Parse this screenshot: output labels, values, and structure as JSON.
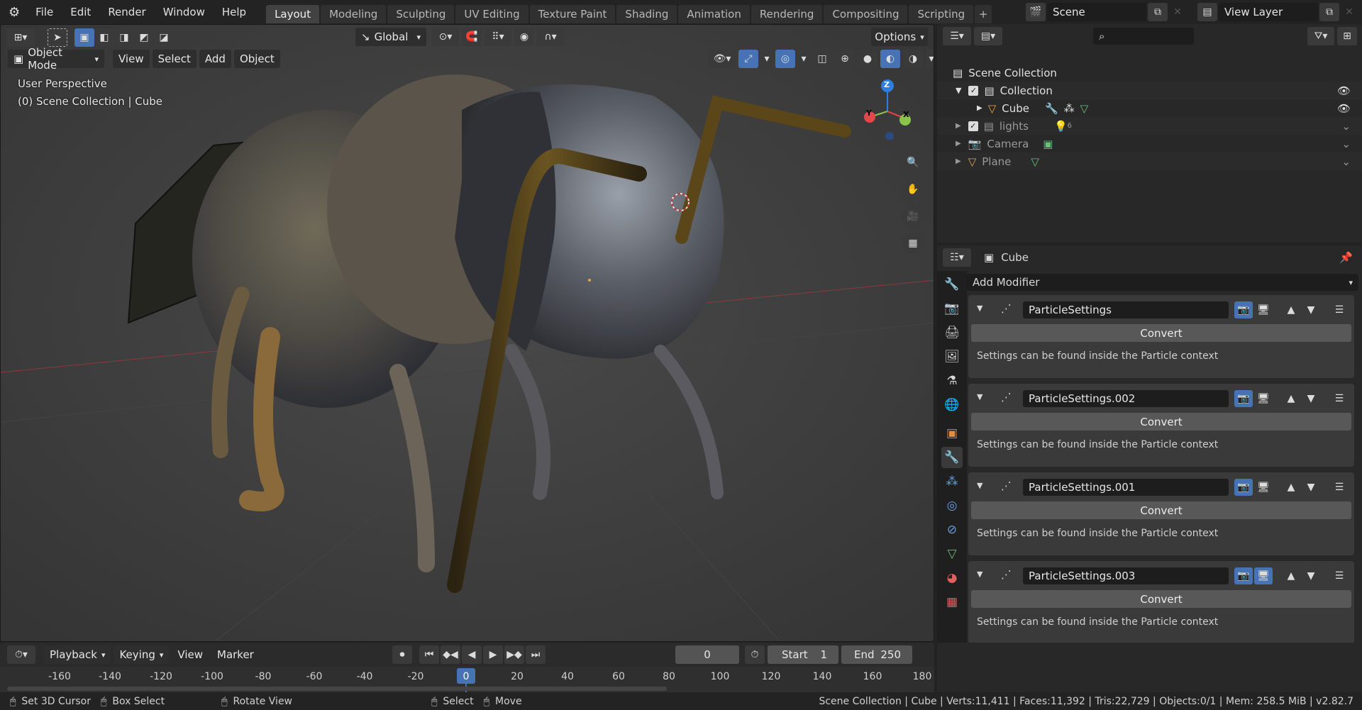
{
  "topbar": {
    "menus": [
      "File",
      "Edit",
      "Render",
      "Window",
      "Help"
    ],
    "tabs": [
      "Layout",
      "Modeling",
      "Sculpting",
      "UV Editing",
      "Texture Paint",
      "Shading",
      "Animation",
      "Rendering",
      "Compositing",
      "Scripting"
    ],
    "active_tab": "Layout",
    "scene": "Scene",
    "view_layer": "View Layer"
  },
  "viewport": {
    "transform_orientation": "Global",
    "options_label": "Options",
    "mode": "Object Mode",
    "header_menus": [
      "View",
      "Select",
      "Add",
      "Object"
    ],
    "overlay_line1": "User Perspective",
    "overlay_line2": "(0) Scene Collection | Cube",
    "gizmo_axes": {
      "z": "Z",
      "y": "Y",
      "x": "X"
    }
  },
  "outliner": {
    "root": "Scene Collection",
    "rows": [
      {
        "label": "Collection",
        "type": "collection"
      },
      {
        "label": "Cube",
        "type": "object"
      },
      {
        "label": "lights",
        "type": "collection",
        "badge": "6"
      },
      {
        "label": "Camera",
        "type": "object"
      },
      {
        "label": "Plane",
        "type": "object"
      }
    ]
  },
  "properties": {
    "object_name": "Cube",
    "add_modifier": "Add Modifier",
    "modifiers": [
      {
        "name": "ParticleSettings",
        "convert": "Convert",
        "note": "Settings can be found inside the Particle context"
      },
      {
        "name": "ParticleSettings.002",
        "convert": "Convert",
        "note": "Settings can be found inside the Particle context"
      },
      {
        "name": "ParticleSettings.001",
        "convert": "Convert",
        "note": "Settings can be found inside the Particle context"
      },
      {
        "name": "ParticleSettings.003",
        "convert": "Convert",
        "note": "Settings can be found inside the Particle context"
      }
    ]
  },
  "timeline": {
    "menus": [
      "Playback",
      "Keying",
      "View",
      "Marker"
    ],
    "current_frame": "0",
    "start_label": "Start",
    "start": "1",
    "end_label": "End",
    "end": "250",
    "ticks": [
      "-160",
      "-140",
      "-120",
      "-100",
      "-80",
      "-60",
      "-40",
      "-20",
      "0",
      "20",
      "40",
      "60",
      "80",
      "100",
      "120",
      "140",
      "160",
      "180"
    ]
  },
  "statusbar": {
    "set_cursor": "Set 3D Cursor",
    "box_select": "Box Select",
    "rotate_view": "Rotate View",
    "select": "Select",
    "move": "Move",
    "stats": "Scene Collection | Cube | Verts:11,411 | Faces:11,392 | Tris:22,729 | Objects:0/1 | Mem: 258.5 MiB | v2.82.7"
  },
  "colors": {
    "accent": "#4772b3",
    "bg": "#232323",
    "panel": "#282828",
    "axis_x": "#e44747",
    "axis_y": "#8bc34a",
    "axis_z": "#2e7de0"
  }
}
